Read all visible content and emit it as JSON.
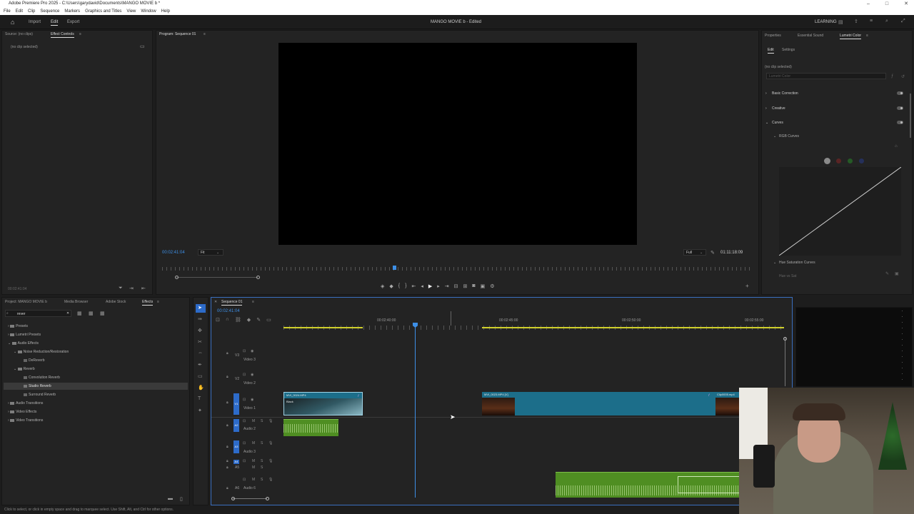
{
  "titlebar": {
    "title": "Adobe Premiere Pro 2025 - C:\\Users\\garydavid\\Documents\\MANGO MOVIE b *"
  },
  "menu": [
    "File",
    "Edit",
    "Clip",
    "Sequence",
    "Markers",
    "Graphics and Titles",
    "View",
    "Window",
    "Help"
  ],
  "appbar": {
    "home_icon": "home-icon",
    "tabs": [
      "Import",
      "Edit",
      "Export"
    ],
    "active_tab": "Edit",
    "project_title": "MANGO MOVIE b - Edited",
    "learning_label": "LEARNING"
  },
  "source_panel": {
    "tab_source": "Source: (no clips)",
    "tab_effect_controls": "Effect Controls",
    "no_clip": "(no clip selected)",
    "timecode": "00:02:41:04"
  },
  "program_monitor": {
    "tab": "Program: Sequence 01",
    "timecode": "00:02:41:04",
    "fit": "Fit",
    "quality": "Full",
    "duration": "01:11:18:09"
  },
  "right_panel": {
    "tabs": [
      "Properties",
      "Essential Sound",
      "Lumetri Color"
    ],
    "subtabs": [
      "Edit",
      "Settings"
    ],
    "no_clip": "(no clip selected)",
    "preset_placeholder": "Lumetri Color",
    "sections": [
      "Basic Correction",
      "Creative",
      "Curves"
    ],
    "rgb_curves": "RGB Curves",
    "hue_sat": "Hue Saturation Curves",
    "hue_vs_sat": "Hue vs Sat"
  },
  "project_panel": {
    "tabs": [
      "Project: MANGO MOVIE b",
      "Media Browser",
      "Adobe Stock",
      "Effects"
    ],
    "search_value": "rever",
    "tree": [
      {
        "label": "Presets",
        "level": 0
      },
      {
        "label": "Lumetri Presets",
        "level": 0
      },
      {
        "label": "Audio Effects",
        "level": 0
      },
      {
        "label": "Noise Reduction/Restoration",
        "level": 1
      },
      {
        "label": "DeReverb",
        "level": 2
      },
      {
        "label": "Reverb",
        "level": 1
      },
      {
        "label": "Convolution Reverb",
        "level": 2
      },
      {
        "label": "Studio Reverb",
        "level": 2
      },
      {
        "label": "Surround Reverb",
        "level": 2
      },
      {
        "label": "Audio Transitions",
        "level": 0
      },
      {
        "label": "Video Effects",
        "level": 0
      },
      {
        "label": "Video Transitions",
        "level": 0
      }
    ]
  },
  "timeline": {
    "tab": "Sequence 01",
    "timecode": "00:02:41:04",
    "ruler": [
      "00:02:40:00",
      "00:02:45:00",
      "00:02:50:00",
      "00:02:55:00"
    ],
    "tracks": [
      {
        "id": "V3",
        "name": "Video 3"
      },
      {
        "id": "V2",
        "name": "Video 2"
      },
      {
        "id": "V1",
        "name": "Video 1"
      },
      {
        "id": "A2",
        "name": "Audio 2"
      },
      {
        "id": "A3",
        "name": "Audio 3"
      },
      {
        "id": "A4",
        "name": ""
      },
      {
        "id": "A5",
        "name": ""
      },
      {
        "id": "A6",
        "name": "Audio 6"
      }
    ],
    "clips": {
      "clip1_name": "MVI_0024.MP4",
      "clip1_sub": "Black",
      "clip2_name": "MVI_0023.MP4 [V]",
      "clip3_name": "Clip0005.mp4"
    }
  },
  "status_bar": "Click to select, or click in empty space and drag to marquee select. Use Shift, Alt, and Ctrl for other options.",
  "colors": {
    "accent": "#2d8ceb",
    "video_clip": "#1c6e8a",
    "audio_clip": "#4f8e22"
  }
}
